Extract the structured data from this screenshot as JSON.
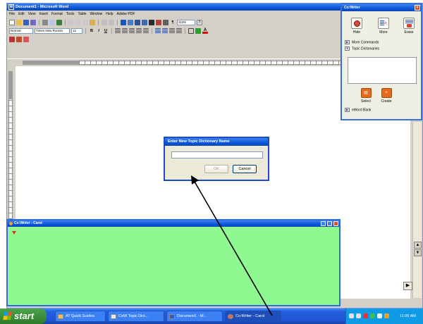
{
  "word": {
    "title": "Document1 - Microsoft Word",
    "menu": [
      "File",
      "Edit",
      "View",
      "Insert",
      "Format",
      "Tools",
      "Table",
      "Window",
      "Help",
      "Adobe PDF"
    ],
    "style_value": "Normal",
    "font_value": "Times New Roman",
    "size_value": "12",
    "zoom_value": "113%",
    "format_buttons": [
      "B",
      "I",
      "U"
    ]
  },
  "cowriter_panel": {
    "title": "Co:Writer",
    "buttons": [
      {
        "label": "Hide",
        "icon": "hide-icon"
      },
      {
        "label": "More",
        "icon": "more-icon"
      },
      {
        "label": "Erase",
        "icon": "erase-icon"
      }
    ],
    "more_commands": "More Commands",
    "topic_dictionaries": "Topic Dictionaries",
    "actions": [
      {
        "label": "Select",
        "icon": "select-icon"
      },
      {
        "label": "Create",
        "icon": "create-icon"
      }
    ],
    "eword_bank": "eWord Bank"
  },
  "dialog": {
    "title": "Enter New Topic Dictionary Name",
    "input_value": "",
    "ok_label": "OK",
    "cancel_label": "Cancel"
  },
  "cowriter_window": {
    "title": "Co:Writer - Carol"
  },
  "taskbar": {
    "start_label": "start",
    "tasks": [
      "AT Quick Guides",
      "CoW Topic Dict...",
      "Document1 - M...",
      "Co:Writer - Carol"
    ],
    "clock": "11:06 AM"
  },
  "colors": {
    "xp_blue": "#0a56d6",
    "cowriter_green": "#90f890",
    "start_green": "#3d8f3b"
  }
}
